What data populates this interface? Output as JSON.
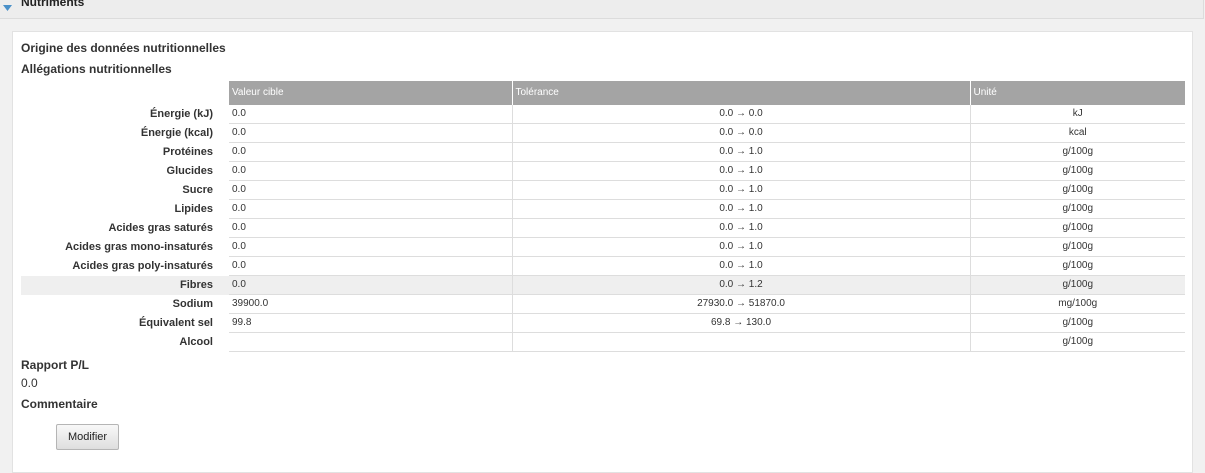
{
  "panel": {
    "title": "Nutriments"
  },
  "sections": {
    "origin": "Origine des données nutritionnelles",
    "claims": "Allégations nutritionnelles",
    "ratio_label": "Rapport P/L",
    "ratio_value": "0.0",
    "comment_label": "Commentaire"
  },
  "table": {
    "headers": [
      "Valeur cible",
      "Tolérance",
      "Unité"
    ],
    "rows": [
      {
        "label": "Énergie (kJ)",
        "target": "0.0",
        "tolerance": "0.0 → 0.0",
        "unit": "kJ"
      },
      {
        "label": "Énergie (kcal)",
        "target": "0.0",
        "tolerance": "0.0 → 0.0",
        "unit": "kcal"
      },
      {
        "label": "Protéines",
        "target": "0.0",
        "tolerance": "0.0 → 1.0",
        "unit": "g/100g"
      },
      {
        "label": "Glucides",
        "target": "0.0",
        "tolerance": "0.0 → 1.0",
        "unit": "g/100g"
      },
      {
        "label": "Sucre",
        "target": "0.0",
        "tolerance": "0.0 → 1.0",
        "unit": "g/100g"
      },
      {
        "label": "Lipides",
        "target": "0.0",
        "tolerance": "0.0 → 1.0",
        "unit": "g/100g"
      },
      {
        "label": "Acides gras saturés",
        "target": "0.0",
        "tolerance": "0.0 → 1.0",
        "unit": "g/100g"
      },
      {
        "label": "Acides gras mono-insaturés",
        "target": "0.0",
        "tolerance": "0.0 → 1.0",
        "unit": "g/100g"
      },
      {
        "label": "Acides gras poly-insaturés",
        "target": "0.0",
        "tolerance": "0.0 → 1.0",
        "unit": "g/100g"
      },
      {
        "label": "Fibres",
        "target": "0.0",
        "tolerance": "0.0 → 1.2",
        "unit": "g/100g"
      },
      {
        "label": "Sodium",
        "target": "39900.0",
        "tolerance": "27930.0 → 51870.0",
        "unit": "mg/100g"
      },
      {
        "label": "Équivalent sel",
        "target": "99.8",
        "tolerance": "69.8 → 130.0",
        "unit": "g/100g"
      },
      {
        "label": "Alcool",
        "target": "",
        "tolerance": "",
        "unit": "g/100g"
      }
    ]
  },
  "buttons": {
    "modify": "Modifier"
  },
  "colors": {
    "header_bg": "#a4a4a4",
    "accent": "#4a90c8"
  },
  "icons": {
    "panel_toggle": "chevron-down-icon"
  }
}
